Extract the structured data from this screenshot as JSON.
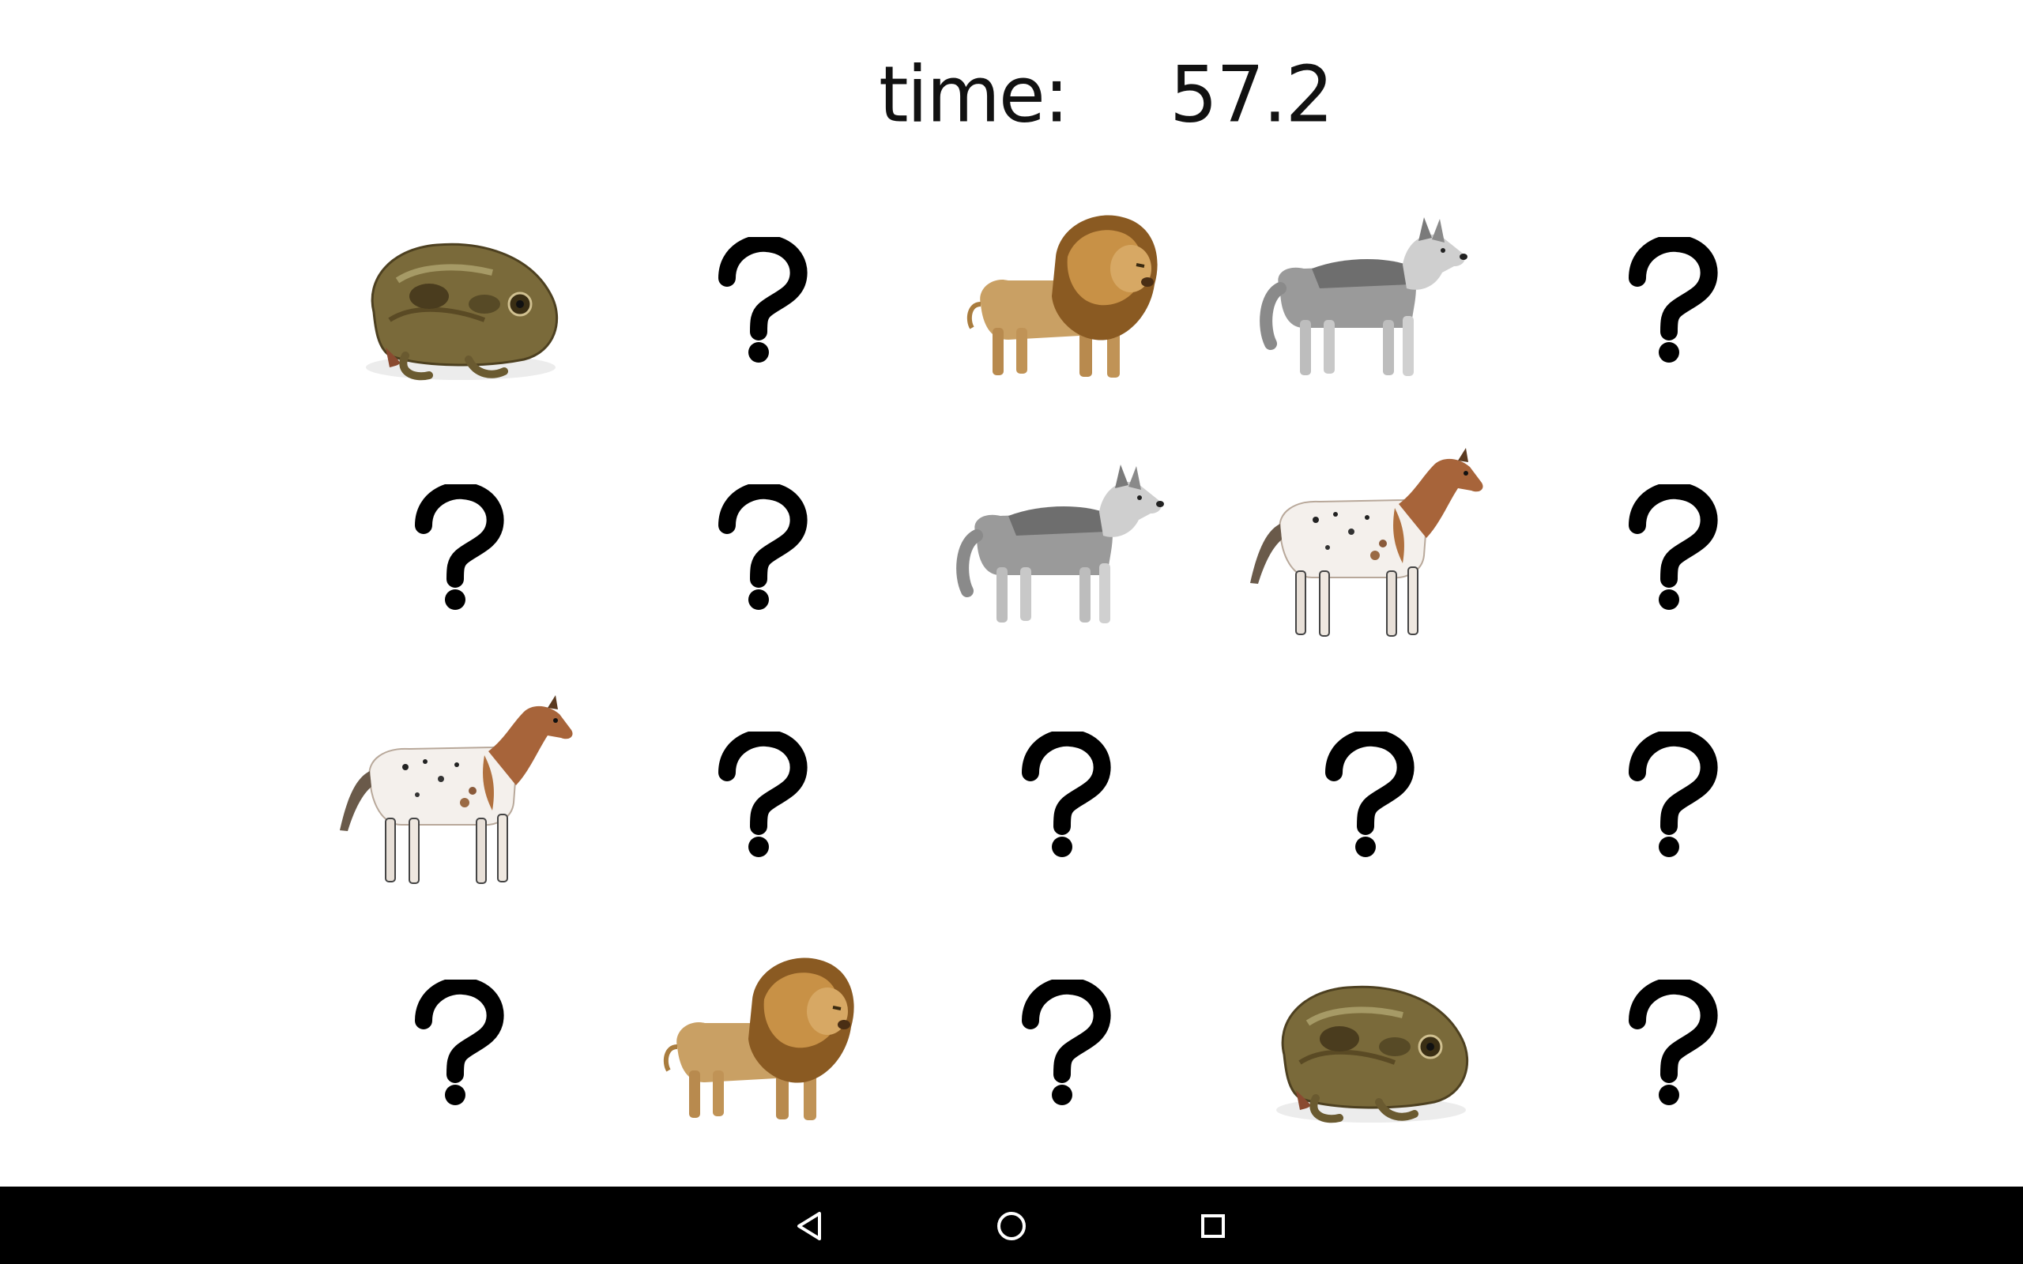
{
  "timer": {
    "label": "time:",
    "value": "57.2"
  },
  "board": {
    "rows": 4,
    "columns": 5,
    "cards": [
      {
        "state": "revealed",
        "animal": "frog"
      },
      {
        "state": "hidden",
        "symbol": "?"
      },
      {
        "state": "revealed",
        "animal": "lion"
      },
      {
        "state": "revealed",
        "animal": "wolf"
      },
      {
        "state": "hidden",
        "symbol": "?"
      },
      {
        "state": "hidden",
        "symbol": "?"
      },
      {
        "state": "hidden",
        "symbol": "?"
      },
      {
        "state": "revealed",
        "animal": "wolf"
      },
      {
        "state": "revealed",
        "animal": "horse"
      },
      {
        "state": "hidden",
        "symbol": "?"
      },
      {
        "state": "revealed",
        "animal": "horse"
      },
      {
        "state": "hidden",
        "symbol": "?"
      },
      {
        "state": "hidden",
        "symbol": "?"
      },
      {
        "state": "hidden",
        "symbol": "?"
      },
      {
        "state": "hidden",
        "symbol": "?"
      },
      {
        "state": "hidden",
        "symbol": "?"
      },
      {
        "state": "revealed",
        "animal": "lion"
      },
      {
        "state": "hidden",
        "symbol": "?"
      },
      {
        "state": "revealed",
        "animal": "frog"
      },
      {
        "state": "hidden",
        "symbol": "?"
      }
    ]
  },
  "navigation_bar": {
    "buttons": [
      {
        "name": "back",
        "icon": "back-triangle-icon"
      },
      {
        "name": "home",
        "icon": "home-circle-icon"
      },
      {
        "name": "recents",
        "icon": "recents-square-icon"
      }
    ]
  }
}
